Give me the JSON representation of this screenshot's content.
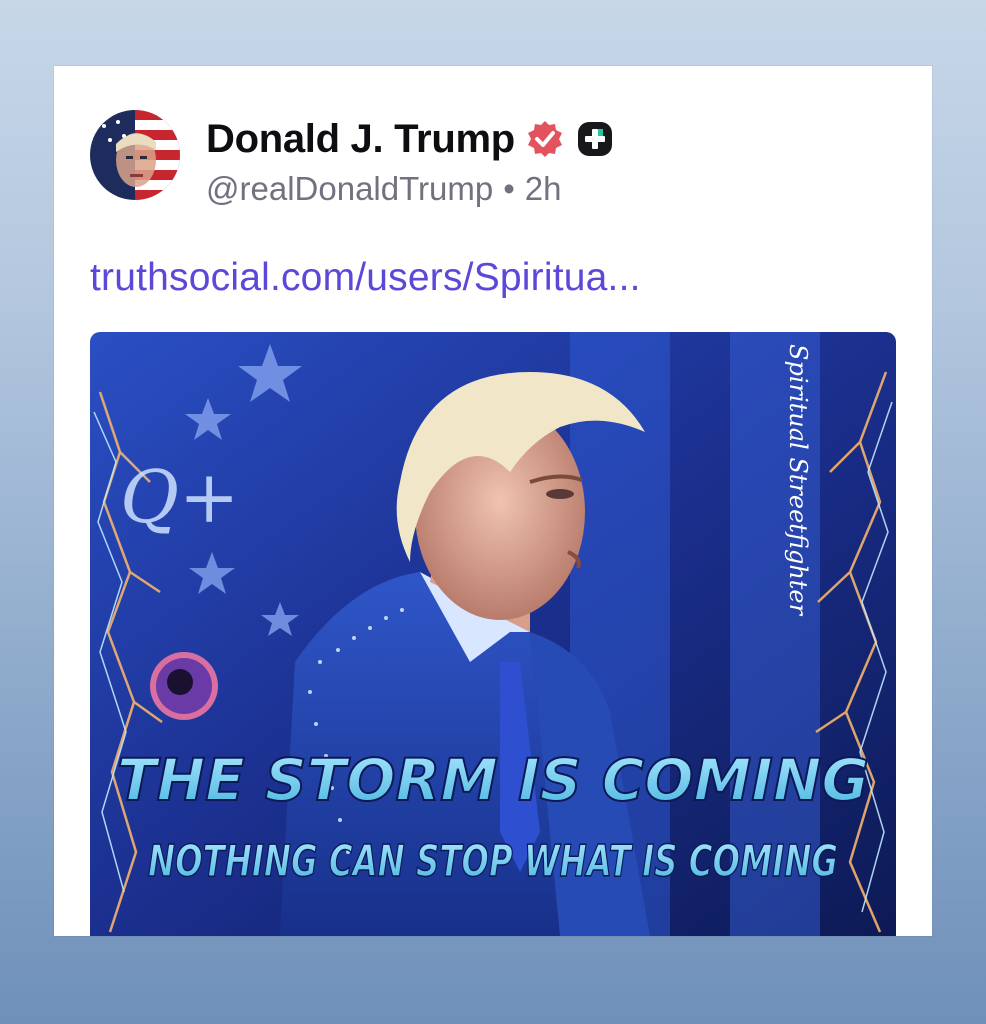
{
  "post": {
    "author": {
      "display_name": "Donald J. Trump",
      "handle": "@realDonaldTrump",
      "verified_icon": "verified-badge-icon",
      "plus_icon": "plus-badge-icon"
    },
    "separator": "•",
    "time": "2h",
    "link_text": "truthsocial.com/users/Spiritua...",
    "media": {
      "headline": "THE STORM IS COMING",
      "subheadline": "NOTHING CAN STOP WHAT IS COMING",
      "watermark": "Spiritual Streetfighter",
      "q_logo": "Q+"
    }
  },
  "colors": {
    "link": "#5b48d9",
    "verified": "#e2535d",
    "headline": "#7fd3f0",
    "background_top": "#c7d7e8",
    "background_bottom": "#6f90ba"
  }
}
